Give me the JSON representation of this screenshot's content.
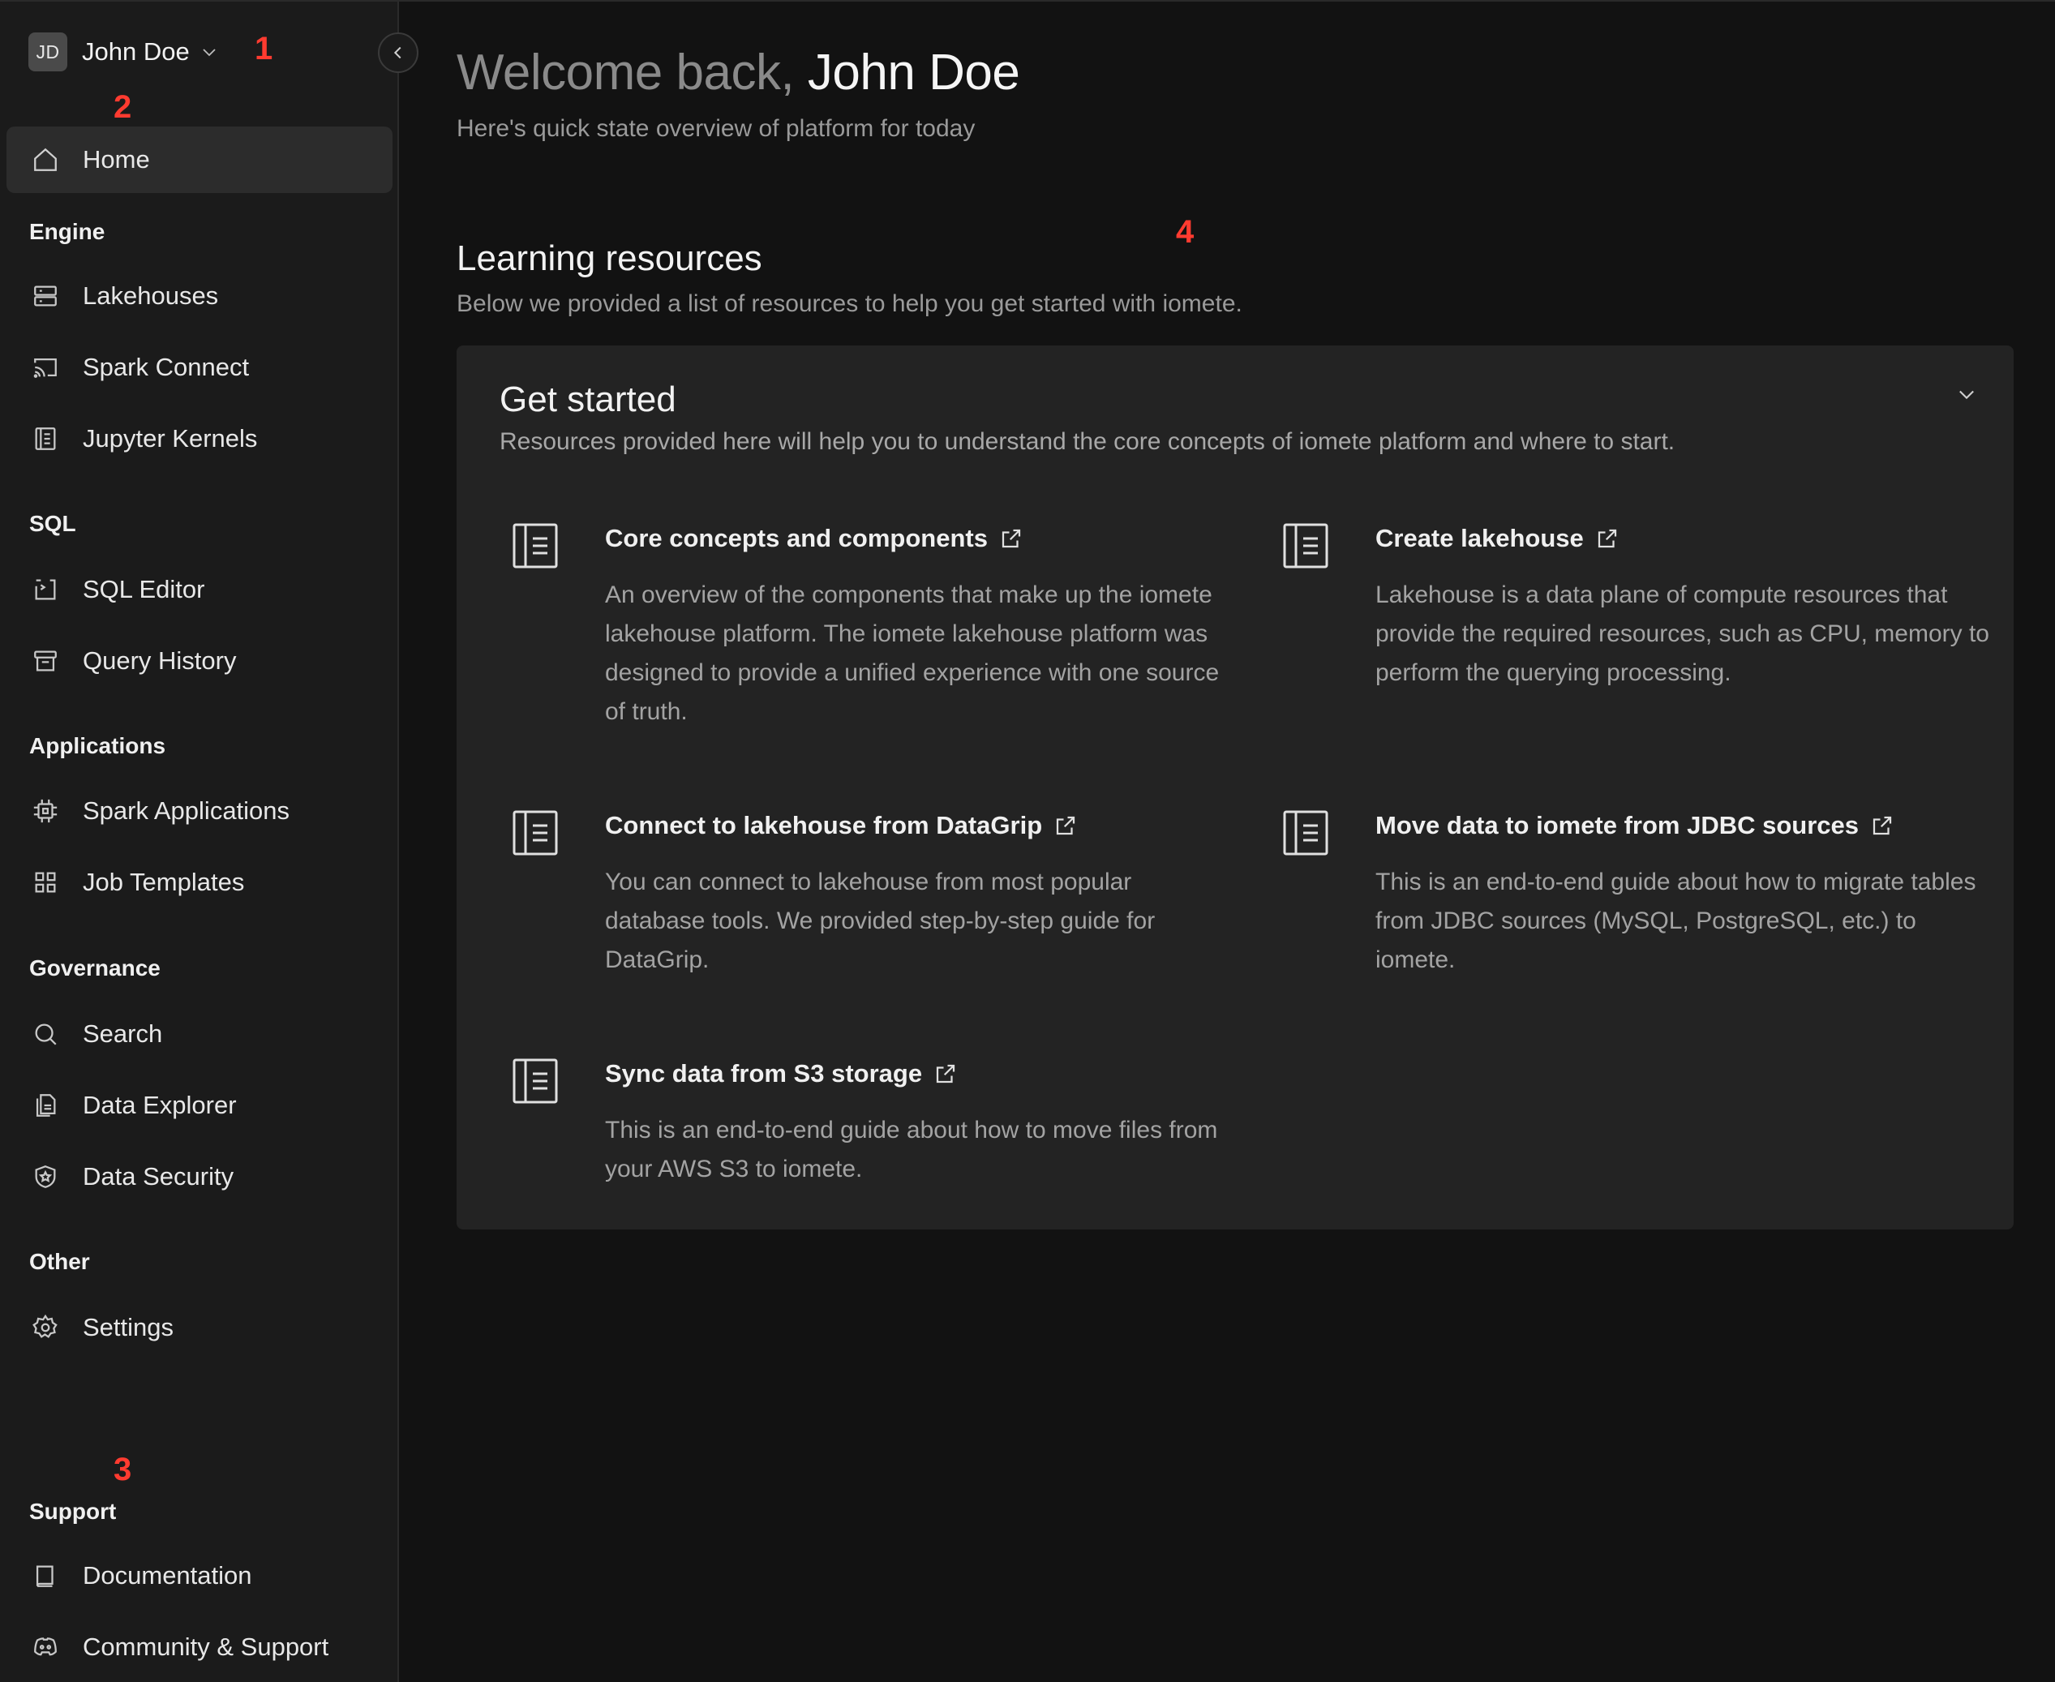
{
  "user": {
    "initials": "JD",
    "name": "John Doe"
  },
  "sidebar": {
    "home": "Home",
    "sections": [
      {
        "label": "Engine",
        "items": [
          "Lakehouses",
          "Spark Connect",
          "Jupyter Kernels"
        ]
      },
      {
        "label": "SQL",
        "items": [
          "SQL Editor",
          "Query History"
        ]
      },
      {
        "label": "Applications",
        "items": [
          "Spark Applications",
          "Job Templates"
        ]
      },
      {
        "label": "Governance",
        "items": [
          "Search",
          "Data Explorer",
          "Data Security"
        ]
      },
      {
        "label": "Other",
        "items": [
          "Settings"
        ]
      },
      {
        "label": "Support",
        "items": [
          "Documentation",
          "Community & Support"
        ]
      }
    ]
  },
  "main": {
    "welcome_prefix": "Welcome back,",
    "welcome_name": "John Doe",
    "subtitle": "Here's quick state overview of platform for today",
    "section_title": "Learning resources",
    "section_desc": "Below we provided a list of resources to help you get started with iomete.",
    "panel": {
      "title": "Get started",
      "desc": "Resources provided here will help you to understand the core concepts of iomete platform and where to start.",
      "resources": [
        {
          "title": "Core concepts and components",
          "desc": "An overview of the components that make up the iomete lakehouse platform. The iomete lakehouse platform was designed to provide a unified experience with one source of truth."
        },
        {
          "title": "Create lakehouse",
          "desc": "Lakehouse is a data plane of compute resources that provide the required resources, such as CPU, memory to perform the querying processing."
        },
        {
          "title": "Connect to lakehouse from DataGrip",
          "desc": "You can connect to lakehouse from most popular database tools. We provided step-by-step guide for DataGrip."
        },
        {
          "title": "Move data to iomete from JDBC sources",
          "desc": "This is an end-to-end guide about how to migrate tables from JDBC sources (MySQL, PostgreSQL, etc.) to iomete."
        },
        {
          "title": "Sync data from S3 storage",
          "desc": "This is an end-to-end guide about how to move files from your AWS S3 to iomete."
        }
      ]
    }
  },
  "markers": [
    "1",
    "2",
    "3",
    "4"
  ],
  "colors": {
    "background": "#121212",
    "sidebar": "#1b1b1b",
    "panel": "#232323",
    "active_item": "#2c2c2c",
    "marker": "#ff3b30"
  }
}
